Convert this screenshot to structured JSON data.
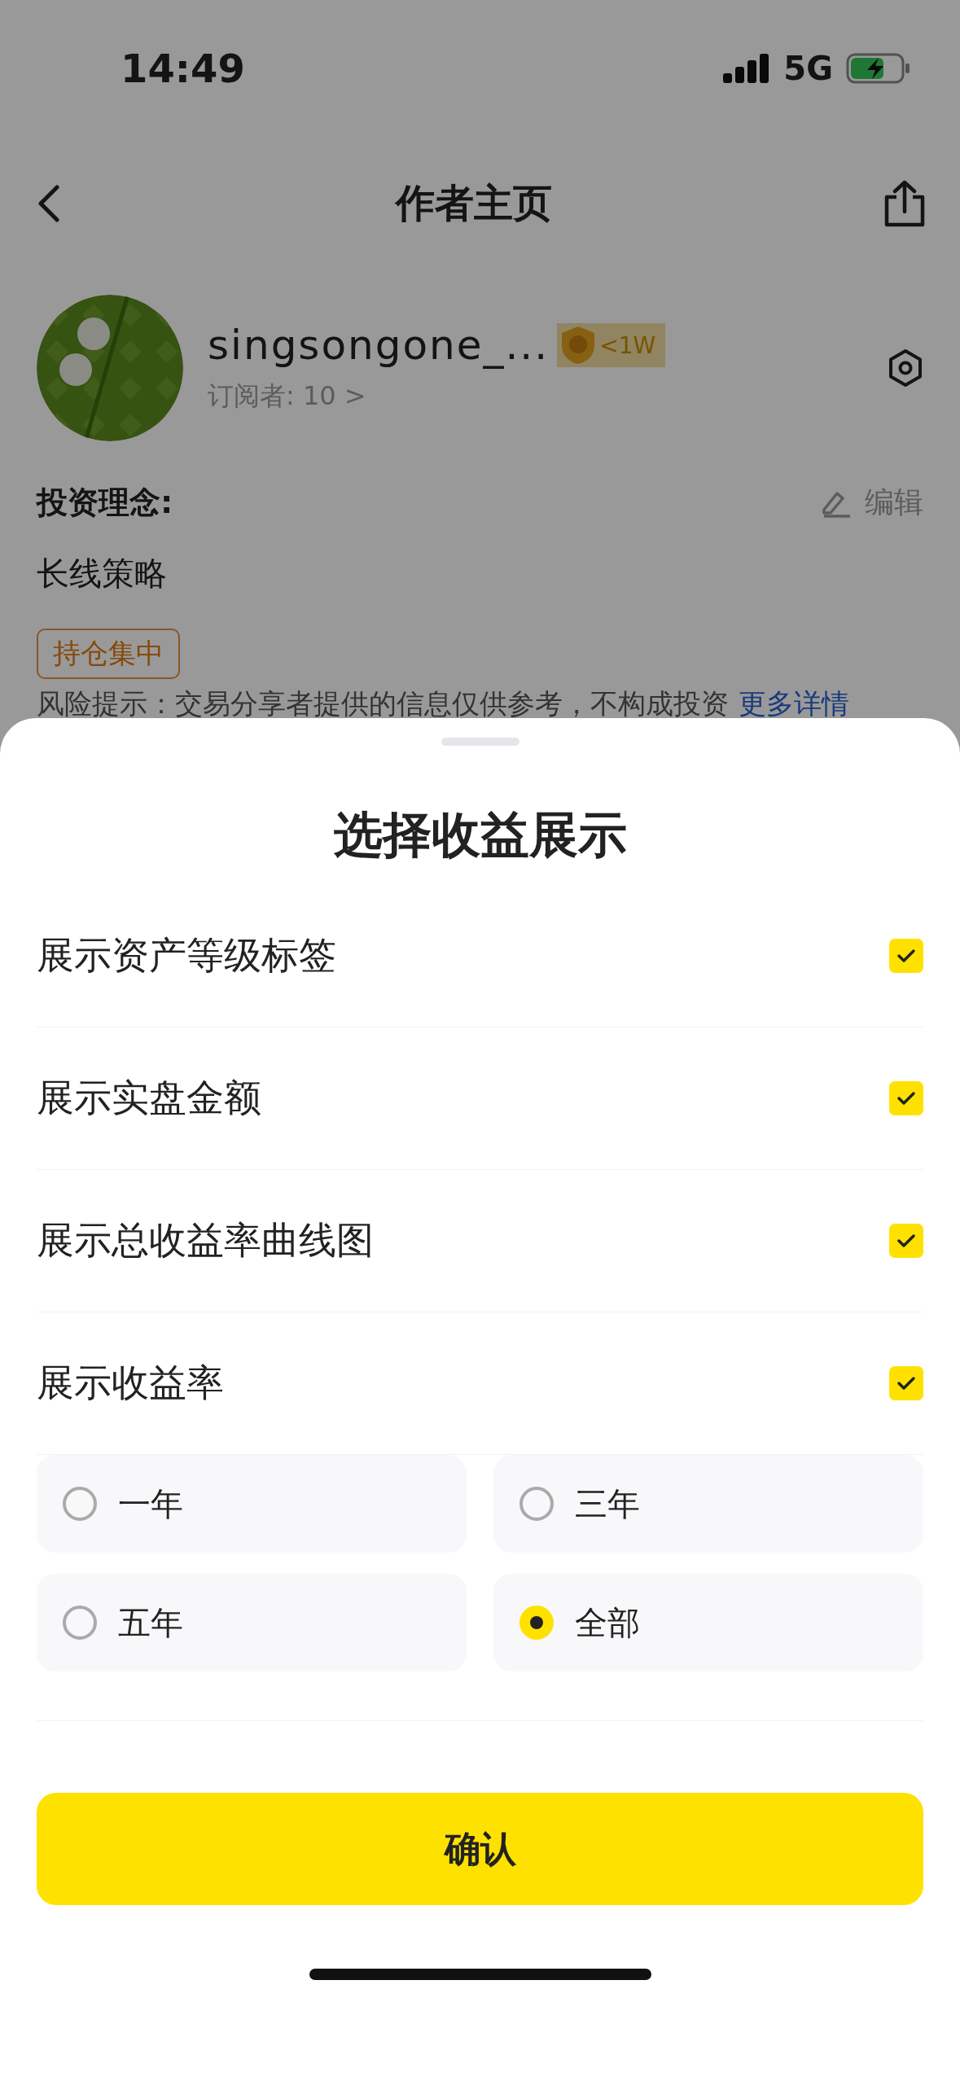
{
  "status_bar": {
    "time": "14:49",
    "network": "5G"
  },
  "nav": {
    "title": "作者主页"
  },
  "profile": {
    "name": "singsongone_...",
    "badge": "<1W",
    "subscribers": "订阅者: 10 >"
  },
  "philosophy": {
    "label": "投资理念:",
    "edit": "编辑",
    "text": "长线策略"
  },
  "tags": [
    "持仓集中"
  ],
  "risk": {
    "text": "风险提示：交易分享者提供的信息仅供参考，不构成投资",
    "link": "更多详情"
  },
  "sheet": {
    "title": "选择收益展示",
    "options": [
      {
        "label": "展示资产等级标签",
        "checked": true
      },
      {
        "label": "展示实盘金额",
        "checked": true
      },
      {
        "label": "展示总收益率曲线图",
        "checked": true
      },
      {
        "label": "展示收益率",
        "checked": true
      }
    ],
    "periods": [
      {
        "label": "一年",
        "selected": false
      },
      {
        "label": "三年",
        "selected": false
      },
      {
        "label": "五年",
        "selected": false
      },
      {
        "label": "全部",
        "selected": true
      }
    ],
    "confirm": "确认"
  }
}
